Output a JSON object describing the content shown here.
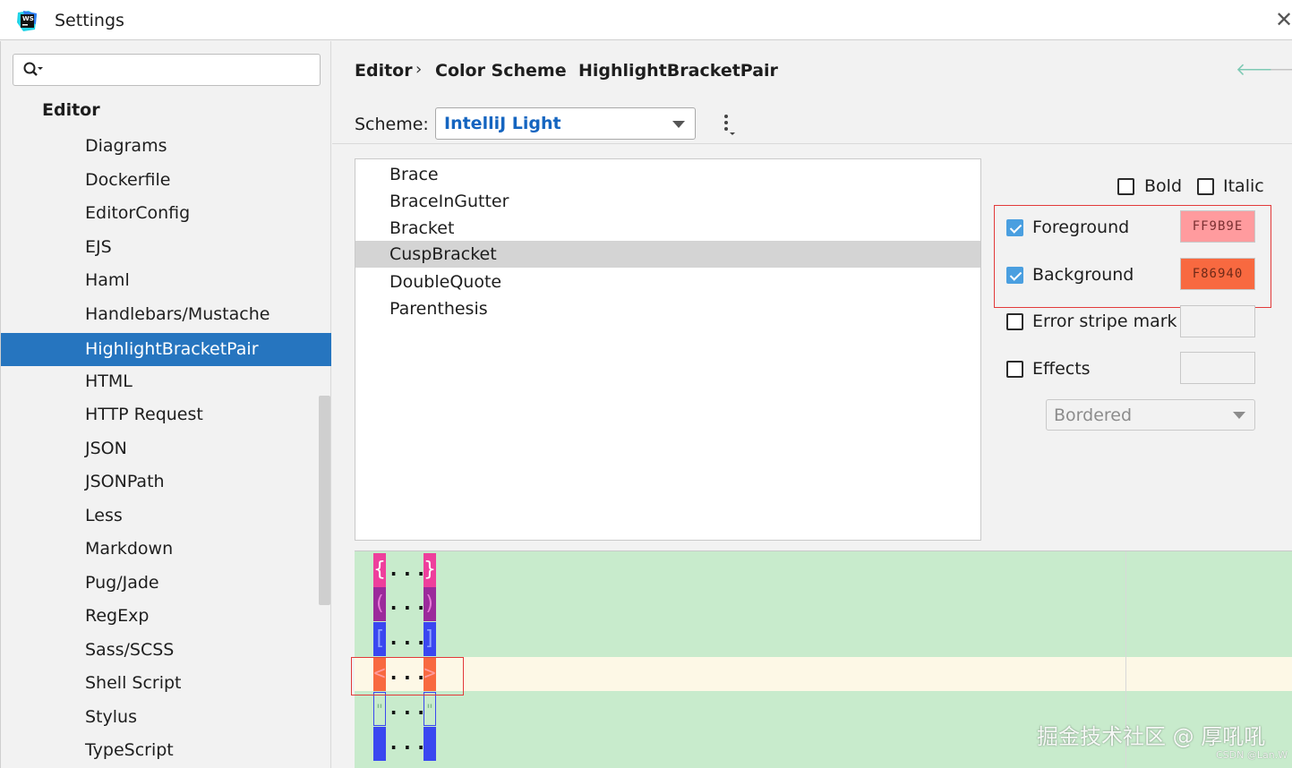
{
  "window": {
    "title": "Settings"
  },
  "search": {
    "placeholder": "",
    "value": ""
  },
  "sidebar": {
    "header": "Editor",
    "items": [
      {
        "label": "Diagrams"
      },
      {
        "label": "Dockerfile"
      },
      {
        "label": "EditorConfig"
      },
      {
        "label": "EJS"
      },
      {
        "label": "Haml"
      },
      {
        "label": "Handlebars/Mustache"
      },
      {
        "label": "HighlightBracketPair",
        "selected": true
      },
      {
        "label": "HTML"
      },
      {
        "label": "HTTP Request"
      },
      {
        "label": "JSON"
      },
      {
        "label": "JSONPath"
      },
      {
        "label": "Less"
      },
      {
        "label": "Markdown"
      },
      {
        "label": "Pug/Jade"
      },
      {
        "label": "RegExp"
      },
      {
        "label": "Sass/SCSS"
      },
      {
        "label": "Shell Script"
      },
      {
        "label": "Stylus"
      },
      {
        "label": "TypeScript"
      }
    ]
  },
  "breadcrumb": [
    "Editor",
    "Color Scheme",
    "HighlightBracketPair"
  ],
  "scheme": {
    "label": "Scheme:",
    "value": "IntelliJ Light"
  },
  "elements": [
    {
      "label": "Brace"
    },
    {
      "label": "BraceInGutter"
    },
    {
      "label": "Bracket"
    },
    {
      "label": "CuspBracket",
      "selected": true
    },
    {
      "label": "DoubleQuote"
    },
    {
      "label": "Parenthesis"
    }
  ],
  "attributes": {
    "bold": {
      "label": "Bold",
      "checked": false
    },
    "italic": {
      "label": "Italic",
      "checked": false
    },
    "foreground": {
      "label": "Foreground",
      "checked": true,
      "value": "FF9B9E",
      "color": "#FF9B9E"
    },
    "background": {
      "label": "Background",
      "checked": true,
      "value": "F86940",
      "color": "#F86940"
    },
    "error_stripe": {
      "label": "Error stripe mark",
      "checked": false
    },
    "effects": {
      "label": "Effects",
      "checked": false,
      "type": "Bordered"
    }
  },
  "preview": {
    "rows": [
      {
        "open": "{",
        "close": "}",
        "dots": "...",
        "bracket_bg": "#ee3f9c",
        "bracket_fg": "#ffffff"
      },
      {
        "open": "(",
        "close": ")",
        "dots": "...",
        "bracket_bg": "#9b2a9b",
        "bracket_fg": "#e67ad8"
      },
      {
        "open": "[",
        "close": "]",
        "dots": "...",
        "bracket_bg": "#3a47f0",
        "bracket_fg": "#8fa0ff"
      },
      {
        "open": "<",
        "close": ">",
        "dots": "...",
        "bracket_bg": "#F86940",
        "bracket_fg": "#FF9B9E"
      },
      {
        "open": "\"",
        "close": "\"",
        "dots": "...",
        "bracket_bg": "#c8ebcc",
        "bracket_fg": "#7fb98a"
      },
      {
        "open": "",
        "close": "",
        "dots": "...",
        "bracket_bg": "#3a47f0",
        "bracket_fg": "#8fa0ff"
      }
    ]
  },
  "watermark": {
    "text": "掘金技术社区 @ 厚吼吼",
    "small": "CSDN @Lan.W"
  }
}
